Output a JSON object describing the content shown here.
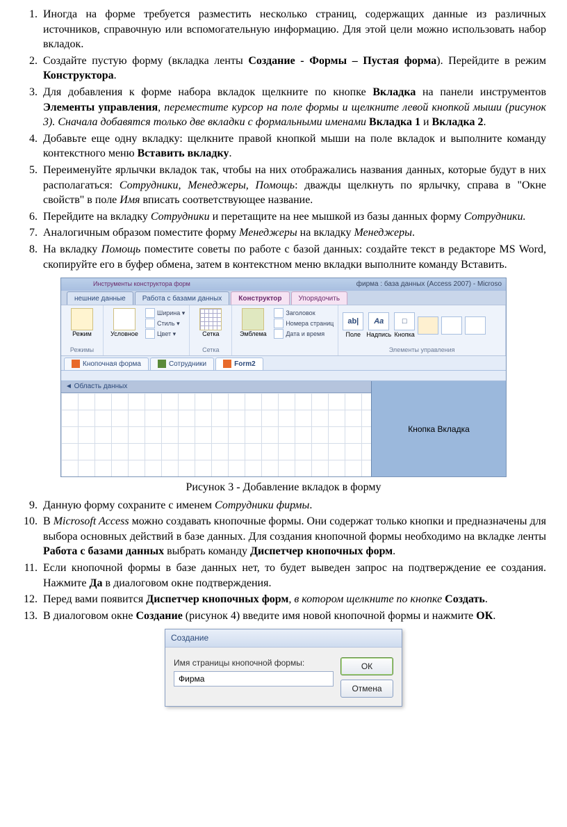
{
  "list": {
    "i1": "Иногда на форме требуется разместить несколько страниц, содержащих данные из различных источников, справочную или вспомогательную информацию. Для этой цели можно использовать набор вкладок.",
    "i2a": "Создайте пустую форму (вкладка ленты ",
    "i2b": "Создание - Формы – Пустая форма",
    "i2c": "). Перейдите в режим ",
    "i2d": "Конструктора",
    "i2e": ".",
    "i3a": "Для добавления к форме набора вкладок щелкните по кнопке ",
    "i3b": "Вкладка",
    "i3c": " на панели инструментов ",
    "i3d": "Элементы управления",
    "i3e": ", переместите курсор на поле формы и щелкните левой кнопкой мыши (рисунок 3). Сначала добавятся только две вкладки с формальными именами ",
    "i3f": "Вкладка 1",
    "i3g": " и ",
    "i3h": "Вкладка 2",
    "i3i": ".",
    "i4a": "Добавьте еще одну вкладку: щелкните правой кнопкой мыши на поле вкладок и выполните команду контекстного меню ",
    "i4b": "Вставить вкладку",
    "i4c": ".",
    "i5a": "Переименуйте ярлычки вкладок так, чтобы на них отображались названия данных, которые будут в них располагаться: ",
    "i5b": "Сотрудники, Менеджеры, Помощь",
    "i5c": ": дважды щелкнуть по ярлычку, справа в \"Окне свойств\" в поле ",
    "i5d": "Имя",
    "i5e": " вписать соответствующее название.",
    "i6a": "Перейдите на вкладку ",
    "i6b": "Сотрудники",
    "i6c": " и перетащите на нее мышкой из базы данных форму ",
    "i6d": "Сотрудники.",
    "i7a": "Аналогичным образом поместите форму ",
    "i7b": "Менеджеры",
    "i7c": " на вкладку ",
    "i7d": "Менеджеры",
    "i7e": ".",
    "i8a": "На вкладку ",
    "i8b": "Помощь",
    "i8c": " поместите советы по работе с базой данных: создайте текст в редакторе MS Word, скопируйте его в буфер обмена, затем в контекстном меню вкладки выполните команду Вставить.",
    "i9a": "Данную форму сохраните с именем ",
    "i9b": "Сотрудники фирмы",
    "i9c": ".",
    "i10a": "В ",
    "i10b": "Microsoft Access",
    "i10c": " можно создавать кнопочные формы. Они содержат только кнопки и предназначены для выбора основных действий в базе данных. Для создания кнопочной формы необходимо на вкладке ленты ",
    "i10d": "Работа с базами данных",
    "i10e": " выбрать команду ",
    "i10f": "Диспетчер кнопочных форм",
    "i10g": ".",
    "i11a": "Если кнопочной формы в базе данных нет, то будет выведен запрос на подтверждение ее создания. Нажмите ",
    "i11b": "Да",
    "i11c": " в диалоговом окне подтверждения.",
    "i12a": "Перед вами появится ",
    "i12b": "Диспетчер кнопочных форм",
    "i12c": ", в котором щелкните по кнопке ",
    "i12d": "Создать",
    "i12e": ".",
    "i13a": "В диалоговом окне ",
    "i13b": "Создание",
    "i13c": " (рисунок 4) введите имя новой кнопочной формы и нажмите ",
    "i13d": "ОК",
    "i13e": "."
  },
  "fig1": {
    "caption": "Рисунок 3 - Добавление вкладок в форму",
    "title_right": "фирма : база данных (Access 2007) - Microso",
    "context_title": "Инструменты конструктора форм",
    "tabs": {
      "t1": "нешние данные",
      "t2": "Работа с базами данных",
      "t3": "Конструктор",
      "t4": "Упорядочить"
    },
    "ribbon": {
      "g1_btn": "Режим",
      "g1_lbl": "Режимы",
      "g2_btn": "Условное",
      "g2_i1": "Ширина ▾",
      "g2_i2": "Стиль ▾",
      "g2_i3": "Цвет ▾",
      "g3_btn": "Сетка",
      "g3_lbl": "Сетка",
      "g4_i1": "Заголовок",
      "g4_i2": "Номера страниц",
      "g4_i3": "Дата и время",
      "g4_btn": "Эмблема",
      "g5_c1": "ab|",
      "g5_c2": "Aa",
      "g5_c3": "□",
      "g5_lbl1": "Поле",
      "g5_lbl2": "Надпись",
      "g5_lbl3": "Кнопка",
      "g5_grp": "Элементы управления"
    },
    "doctabs": {
      "d1": "Кнопочная форма",
      "d2": "Сотрудники",
      "d3": "Form2"
    },
    "section": "◄ Область данных",
    "callout": "Кнопка  Вкладка"
  },
  "fig2": {
    "title": "Создание",
    "label": "Имя страницы кнопочной формы:",
    "value": "Фирма",
    "ok": "ОК",
    "cancel": "Отмена"
  }
}
